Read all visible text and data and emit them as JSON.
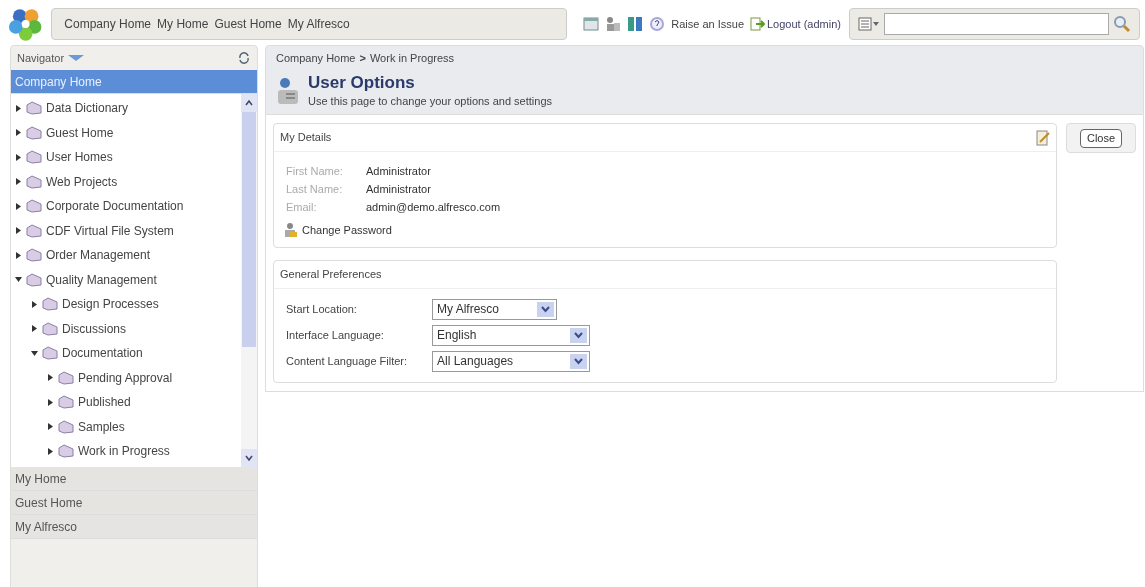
{
  "header": {
    "nav_links": [
      "Company Home",
      "My Home",
      "Guest Home",
      "My Alfresco"
    ],
    "raise_issue": "Raise an Issue",
    "logout": "Logout (admin)"
  },
  "navigator": {
    "title": "Navigator",
    "sections": [
      {
        "label": "Company Home",
        "selected": true
      }
    ],
    "tree": [
      {
        "label": "Data Dictionary",
        "expanded": false
      },
      {
        "label": "Guest Home",
        "expanded": false
      },
      {
        "label": "User Homes",
        "expanded": false
      },
      {
        "label": "Web Projects",
        "expanded": false
      },
      {
        "label": "Corporate Documentation",
        "expanded": false
      },
      {
        "label": "CDF Virtual File System",
        "expanded": false
      },
      {
        "label": "Order Management",
        "expanded": false
      },
      {
        "label": "Quality Management",
        "expanded": true,
        "children": [
          {
            "label": "Design Processes",
            "expanded": false
          },
          {
            "label": "Discussions",
            "expanded": false
          },
          {
            "label": "Documentation",
            "expanded": true,
            "children": [
              {
                "label": "Pending Approval",
                "expanded": false
              },
              {
                "label": "Published",
                "expanded": false
              },
              {
                "label": "Samples",
                "expanded": false
              },
              {
                "label": "Work in Progress",
                "expanded": false
              }
            ]
          }
        ]
      }
    ],
    "other_sections": [
      {
        "label": "My Home",
        "selected": false
      },
      {
        "label": "Guest Home",
        "selected": false
      },
      {
        "label": "My Alfresco",
        "selected": false
      }
    ]
  },
  "breadcrumb": [
    "Company Home",
    "Work in Progress"
  ],
  "breadcrumb_separator": ">",
  "page": {
    "title": "User Options",
    "subtitle": "Use this page to change your options and settings"
  },
  "my_details": {
    "title": "My Details",
    "fields": [
      {
        "label": "First Name:",
        "value": "Administrator"
      },
      {
        "label": "Last Name:",
        "value": "Administrator"
      },
      {
        "label": "Email:",
        "value": "admin@demo.alfresco.com"
      }
    ],
    "change_password": "Change Password"
  },
  "close_button": "Close",
  "general_preferences": {
    "title": "General Preferences",
    "fields": [
      {
        "label": "Start Location:",
        "value": "My Alfresco"
      },
      {
        "label": "Interface Language:",
        "value": "English"
      },
      {
        "label": "Content Language Filter:",
        "value": "All Languages"
      }
    ]
  }
}
